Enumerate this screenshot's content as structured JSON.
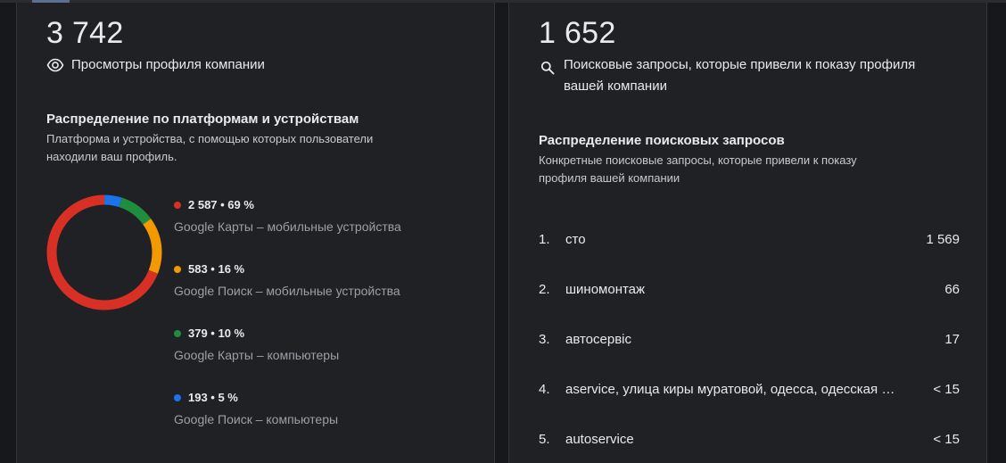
{
  "views": {
    "total": "3 742",
    "label": "Просмотры профиля компании",
    "icon": "eye-icon"
  },
  "platforms": {
    "title": "Распределение по платформам и устройствам",
    "description_line1": "Платформа и устройства, с помощью которых пользователи",
    "description_line2": "находили ваш профиль.",
    "items": [
      {
        "value": "2 587 • 69 %",
        "label": "Google Карты – мобильные устройства",
        "color": "#d93025",
        "share": 69
      },
      {
        "value": "583 • 16 %",
        "label": "Google Поиск – мобильные устройства",
        "color": "#f29900",
        "share": 16
      },
      {
        "value": "379 • 10 %",
        "label": "Google Карты – компьютеры",
        "color": "#1e8e3e",
        "share": 10
      },
      {
        "value": "193 • 5 %",
        "label": "Google Поиск – компьютеры",
        "color": "#1a73e8",
        "share": 5
      }
    ]
  },
  "searches": {
    "total": "1 652",
    "label_line1": "Поисковые запросы, которые привели к показу профиля",
    "label_line2": "вашей компании",
    "icon": "search-icon",
    "title": "Распределение поисковых запросов",
    "description_line1": "Конкретные поисковые запросы, которые привели к показу",
    "description_line2": "профиля вашей компании",
    "queries": [
      {
        "index": "1.",
        "text": "сто",
        "count": "1 569"
      },
      {
        "index": "2.",
        "text": "шиномонтаж",
        "count": "66"
      },
      {
        "index": "3.",
        "text": "автосервіс",
        "count": "17"
      },
      {
        "index": "4.",
        "text": "aservice, улица киры муратовой, одесса, одесская область",
        "count": "< 15"
      },
      {
        "index": "5.",
        "text": "autoservice",
        "count": "< 15"
      }
    ]
  }
}
